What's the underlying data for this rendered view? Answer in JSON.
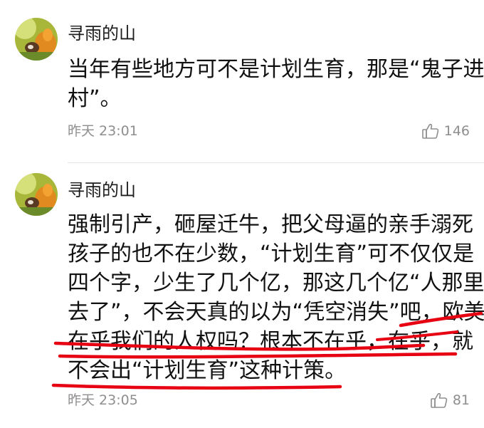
{
  "comments": [
    {
      "username": "寻雨的山",
      "lines": [
        "当年有些地方可不是计划生育，那是“鬼子进",
        "村”。"
      ],
      "time": "昨天 23:01",
      "likes": "146"
    },
    {
      "username": "寻雨的山",
      "lines": [
        "强制引产，砸屋迁牛，把父母逼的亲手溺死",
        "孩子的也不在少数，“计划生育”可不仅仅是",
        "四个字，少生了几个亿，那这几个亿“人那里",
        "去了”，不会天真的以为“凭空消失”吧，欧美",
        "在乎我们的人权吗？根本不在乎，在乎，就",
        "不会出“计划生育”这种计策。"
      ],
      "time": "昨天 23:05",
      "likes": "81"
    }
  ],
  "icons": {
    "like": "thumbs-up-outline-icon"
  },
  "colors": {
    "username": "#1c1c1c",
    "body": "#111111",
    "meta": "#8e8e8e",
    "annotation": "#e60012"
  }
}
